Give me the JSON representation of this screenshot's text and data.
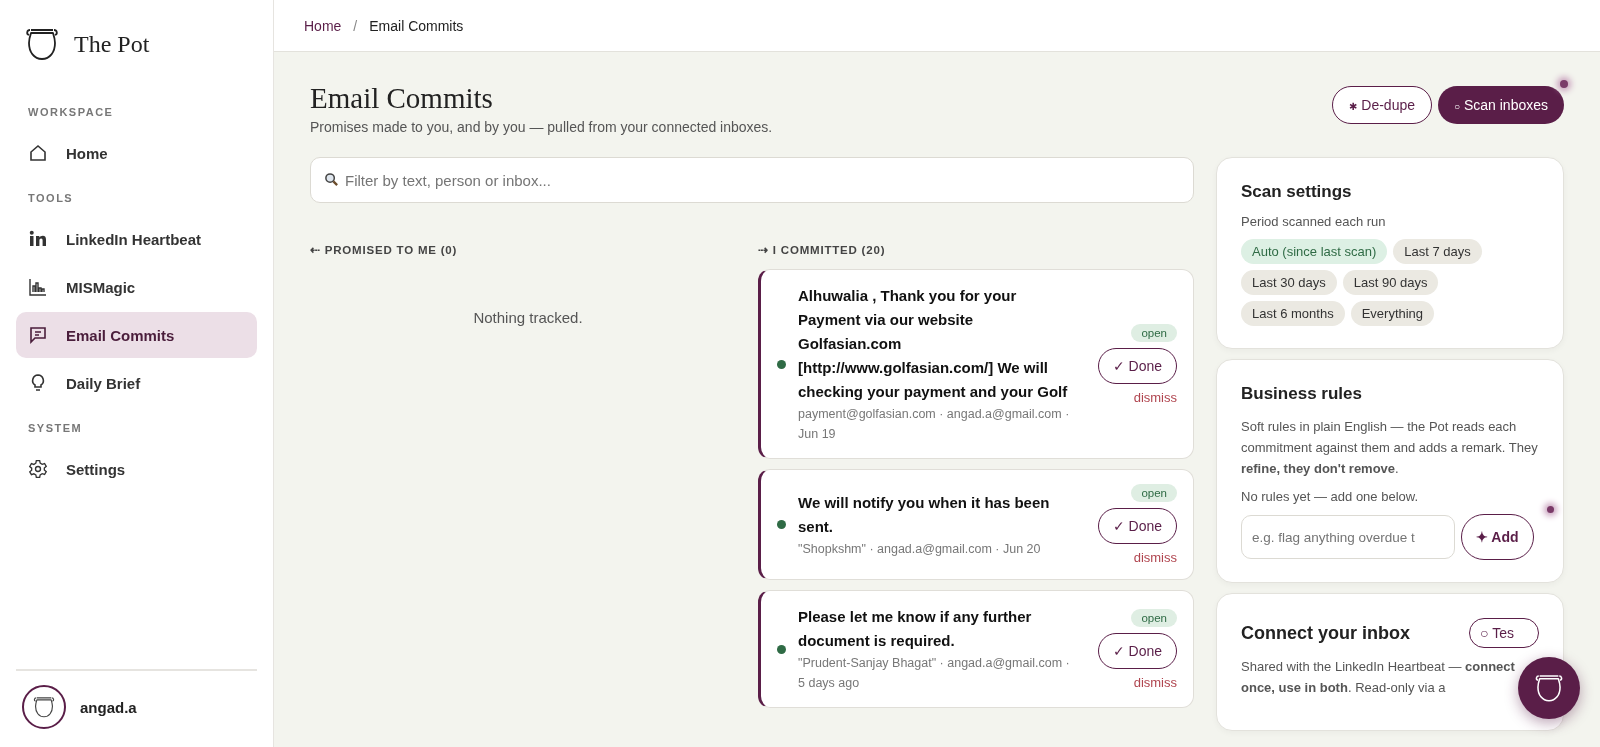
{
  "brand": {
    "name": "The Pot"
  },
  "sidebar": {
    "sections": [
      {
        "heading": "WORKSPACE",
        "items": [
          {
            "label": "Home",
            "selected": false
          }
        ]
      },
      {
        "heading": "TOOLS",
        "items": [
          {
            "label": "LinkedIn Heartbeat",
            "selected": false
          },
          {
            "label": "MISMagic",
            "selected": false
          },
          {
            "label": "Email Commits",
            "selected": true
          },
          {
            "label": "Daily Brief",
            "selected": false
          }
        ]
      },
      {
        "heading": "SYSTEM",
        "items": [
          {
            "label": "Settings",
            "selected": false
          }
        ]
      }
    ],
    "user": {
      "name": "angad.a"
    }
  },
  "breadcrumb": {
    "items": [
      "Home",
      "Email Commits"
    ],
    "separator": "/"
  },
  "page": {
    "title": "Email Commits",
    "subtitle": "Promises made to you, and by you — pulled from your connected inboxes.",
    "actions": [
      {
        "glyph": "✱",
        "label": "De-dupe",
        "kind": "outline"
      },
      {
        "glyph": "○",
        "label": "Scan inboxes",
        "kind": "primary"
      }
    ]
  },
  "filter": {
    "placeholder": "Filter by text, person or inbox..."
  },
  "promised": {
    "heading": "⇠ PROMISED TO ME (0)",
    "empty": "Nothing tracked."
  },
  "committed": {
    "heading": "⇢ I COMMITTED (20)",
    "items": [
      {
        "text": "Alhuwalia , Thank you for your Payment via our website Golfasian.com [http://www.golfasian.com/] We will checking your payment and your Golf",
        "meta": "payment@golfasian.com · angad.a@gmail.com · Jun 19",
        "status": "open",
        "color": "#2f6b45",
        "done": "✓ Done",
        "dismiss": "dismiss"
      },
      {
        "text": "We will notify you when it has been sent.",
        "meta": "\"Shopkshm\" · angad.a@gmail.com · Jun 20",
        "status": "open",
        "color": "#2f6b45",
        "done": "✓ Done",
        "dismiss": "dismiss"
      },
      {
        "text": "Please let me know if any further document is required.",
        "meta": "\"Prudent-Sanjay Bhagat\" · angad.a@gmail.com · 5 days ago",
        "status": "open",
        "color": "#2f6b45",
        "done": "✓ Done",
        "dismiss": "dismiss"
      }
    ]
  },
  "scan_settings": {
    "title": "Scan settings",
    "label": "Period scanned each run",
    "options": [
      {
        "label": "Auto (since last scan)",
        "selected": true
      },
      {
        "label": "Last 7 days",
        "selected": false
      },
      {
        "label": "Last 30 days",
        "selected": false
      },
      {
        "label": "Last 90 days",
        "selected": false
      },
      {
        "label": "Last 6 months",
        "selected": false
      },
      {
        "label": "Everything",
        "selected": false
      }
    ]
  },
  "business_rules": {
    "title": "Business rules",
    "description": "Soft rules in plain English — the Pot reads each commitment against them and adds a remark. They **refine, they don't remove**.",
    "empty": "No rules yet — add one below.",
    "placeholder": "e.g. flag anything overdue t",
    "add": "✦ Add"
  },
  "connect_inbox": {
    "title": "Connect your inbox",
    "test": "○ Tes",
    "description": "Shared with the LinkedIn Heartbeat — **connect once, use in both**. Read-only via a"
  }
}
